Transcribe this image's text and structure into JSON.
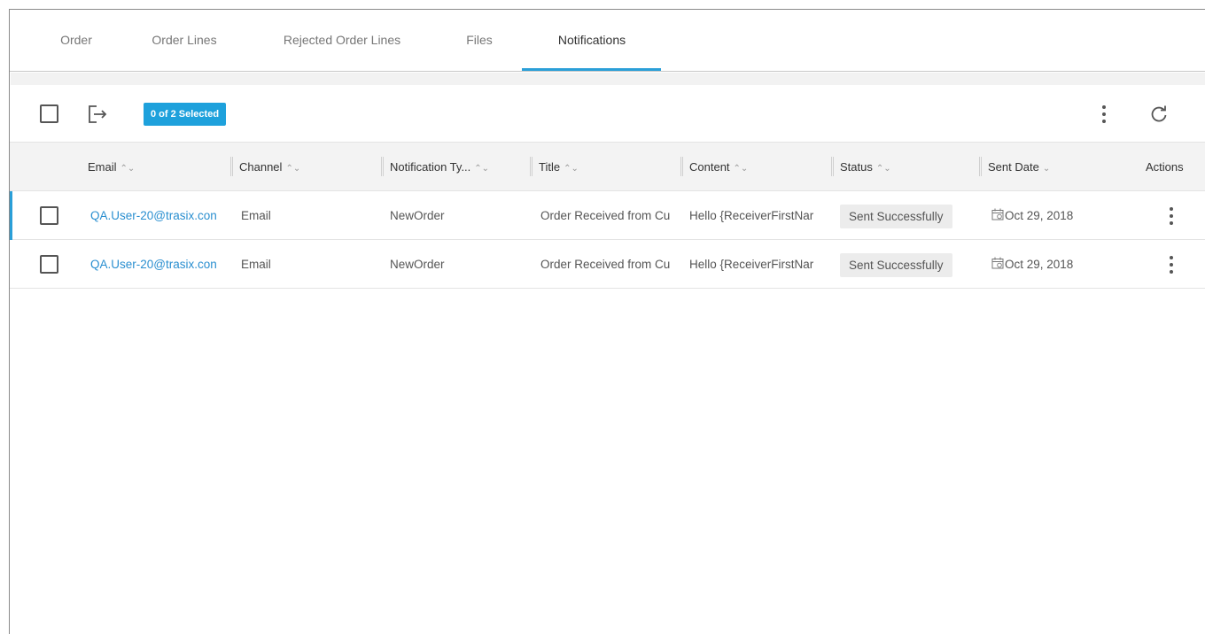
{
  "tabs": [
    {
      "label": "Order",
      "active": false
    },
    {
      "label": "Order Lines",
      "active": false
    },
    {
      "label": "Rejected Order Lines",
      "active": false
    },
    {
      "label": "Files",
      "active": false
    },
    {
      "label": "Notifications",
      "active": true
    }
  ],
  "toolbar": {
    "selection_badge": "0 of 2 Selected",
    "icons": [
      "checkbox",
      "export-icon",
      "more-vert-icon",
      "refresh-icon"
    ]
  },
  "table": {
    "columns": [
      {
        "label": "Email",
        "sort": "⌃⌄"
      },
      {
        "label": "Channel",
        "sort": "⌃⌄"
      },
      {
        "label": "Notification Ty...",
        "sort": "⌃⌄"
      },
      {
        "label": "Title",
        "sort": "⌃⌄"
      },
      {
        "label": "Content",
        "sort": "⌃⌄"
      },
      {
        "label": "Status",
        "sort": "⌃⌄"
      },
      {
        "label": "Sent Date",
        "sort": "⌄"
      },
      {
        "label": "Actions",
        "sort": ""
      }
    ],
    "rows": [
      {
        "email": "QA.User-20@trasix.con",
        "channel": "Email",
        "type": "NewOrder",
        "title": "Order Received from Cu",
        "content": "Hello {ReceiverFirstNar",
        "status": "Sent Successfully",
        "sent_date": "Oct 29, 2018"
      },
      {
        "email": "QA.User-20@trasix.con",
        "channel": "Email",
        "type": "NewOrder",
        "title": "Order Received from Cu",
        "content": "Hello {ReceiverFirstNar",
        "status": "Sent Successfully",
        "sent_date": "Oct 29, 2018"
      }
    ]
  },
  "colors": {
    "accent": "#2a9fd8",
    "badge": "#1ea1dc",
    "link": "#2a8fd0",
    "header_bg": "#f3f3f3",
    "status_bg": "#ececec"
  }
}
